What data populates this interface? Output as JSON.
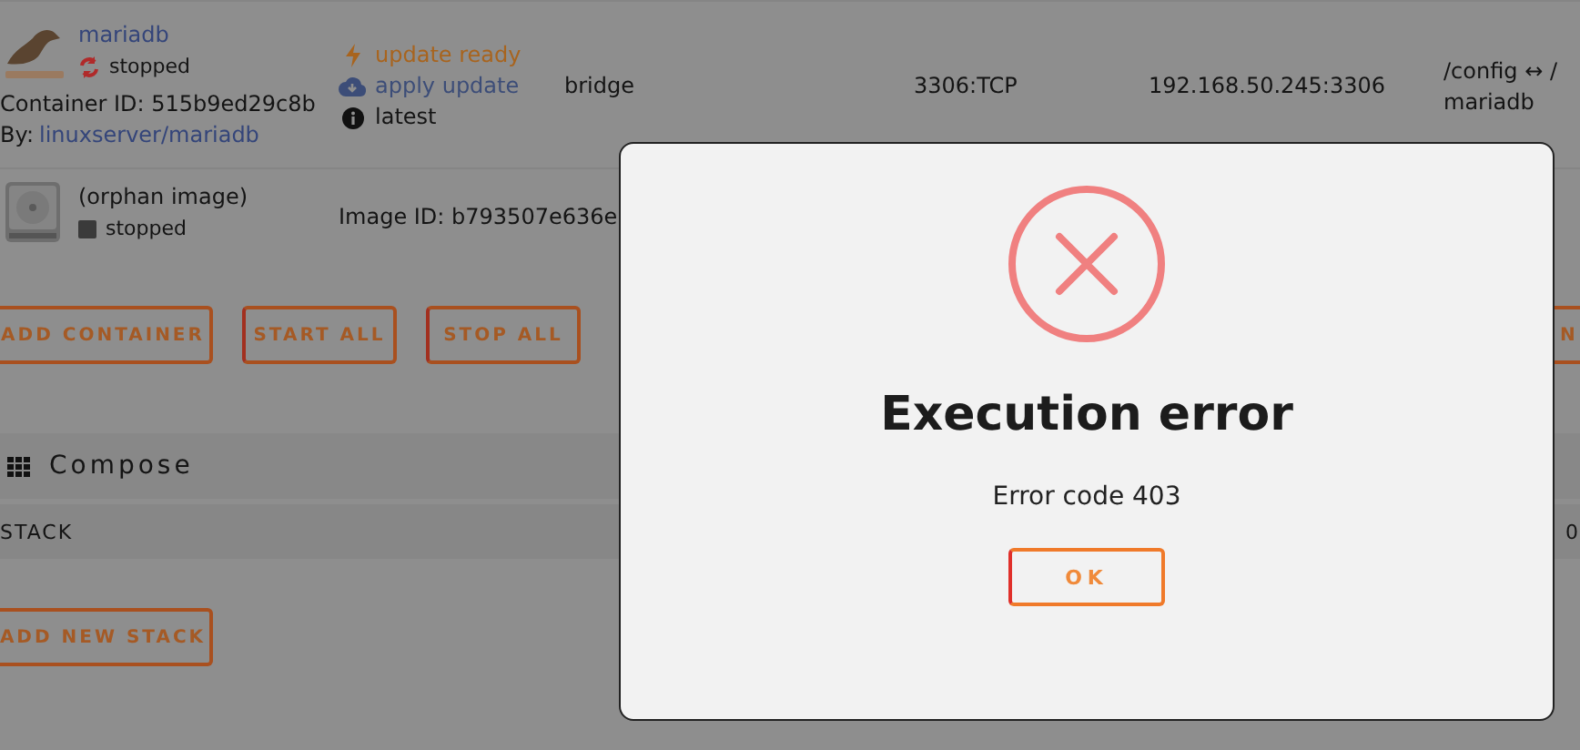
{
  "containers": [
    {
      "kind": "container",
      "name": "mariadb",
      "status": {
        "kind": "cycle",
        "label": "stopped"
      },
      "container_id": "Container ID: 515b9ed29c8b",
      "by_label": "By:",
      "by_link": "linuxserver/mariadb",
      "updates": [
        {
          "kind": "bolt",
          "label": "update ready"
        },
        {
          "kind": "cloud",
          "label": "apply update"
        },
        {
          "kind": "info",
          "label": "latest"
        }
      ],
      "network": "bridge",
      "port": "3306:TCP",
      "address": "192.168.50.245:3306",
      "volume": [
        "/config ↔ /",
        "mariadb"
      ]
    },
    {
      "kind": "orphan",
      "name": "(orphan image)",
      "status": {
        "kind": "square",
        "label": "stopped"
      },
      "image_id": "Image ID: b793507e636e"
    }
  ],
  "actions": [
    "ADD CONTAINER",
    "START ALL",
    "STOP ALL",
    "N"
  ],
  "compose": {
    "title": "Compose",
    "columns": [
      "STACK",
      "0"
    ],
    "button": "ADD NEW STACK"
  },
  "dialog": {
    "title": "Execution error",
    "message": "Error code 403",
    "button": "OK"
  }
}
